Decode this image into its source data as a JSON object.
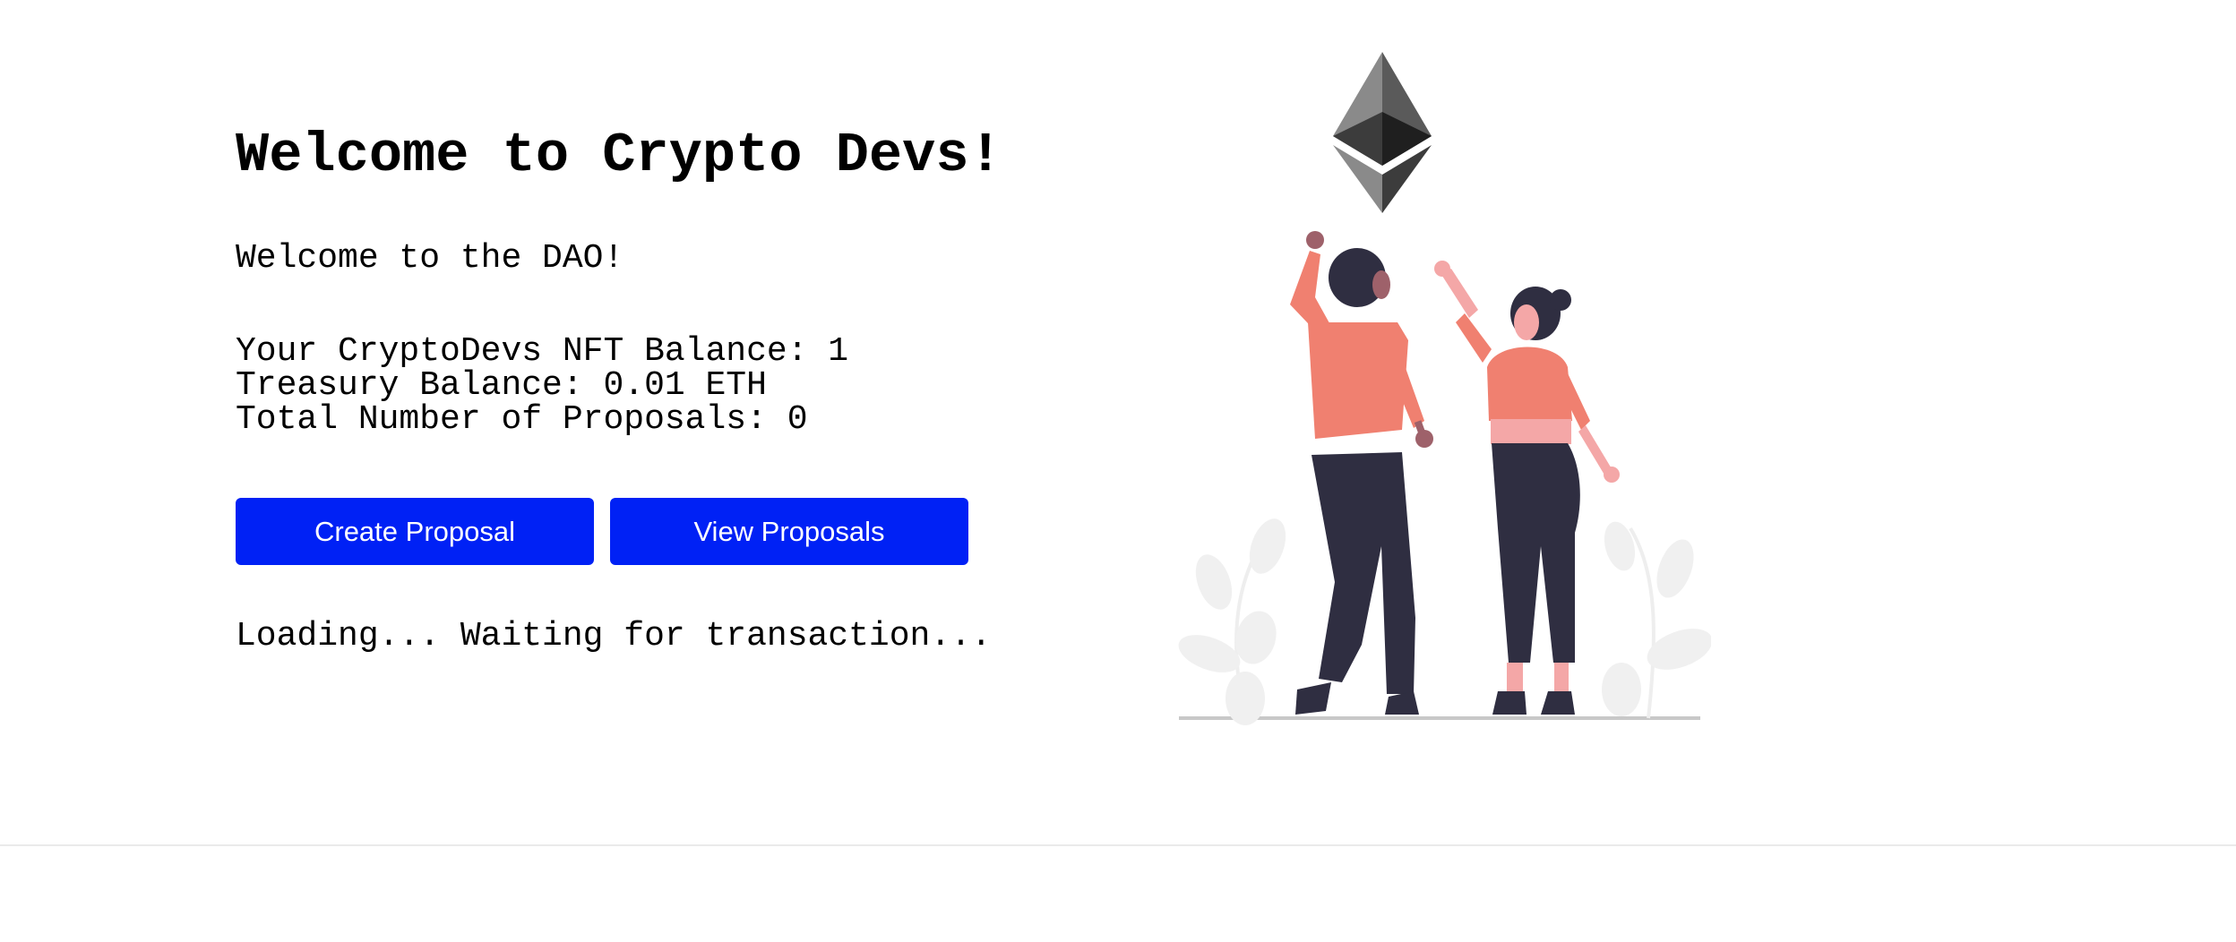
{
  "main": {
    "title": "Welcome to Crypto Devs!",
    "subtitle": "Welcome to the DAO!",
    "nft_balance": "Your CryptoDevs NFT Balance: 1",
    "treasury_balance": "Treasury Balance: 0.01 ETH",
    "proposals_count": "Total Number of Proposals: 0",
    "buttons": {
      "create": "Create Proposal",
      "view": "View Proposals"
    },
    "status": "Loading... Waiting for transaction..."
  },
  "colors": {
    "button_bg": "#0021f5",
    "button_text": "#ffffff",
    "illustration_accent": "#f08070",
    "illustration_dark": "#2f2e41"
  },
  "illustration": {
    "icons": [
      "ethereum-icon",
      "man-figure",
      "woman-figure",
      "plant-left",
      "plant-right"
    ]
  }
}
